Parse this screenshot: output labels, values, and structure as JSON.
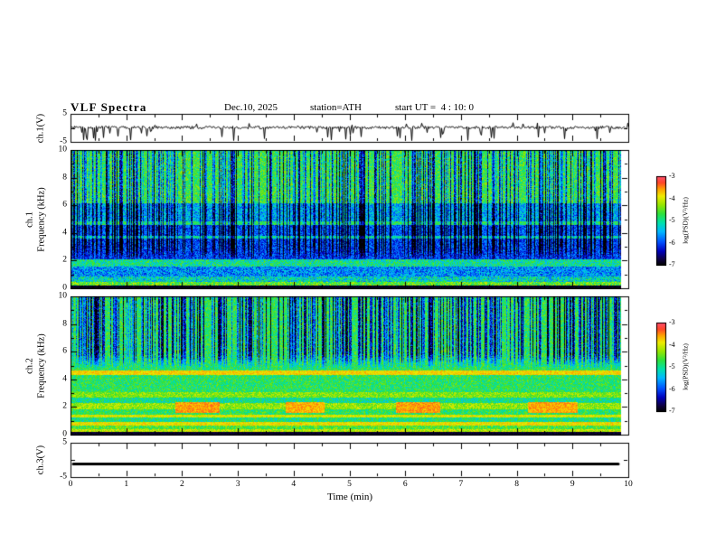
{
  "header": {
    "title": "VLF Spectra",
    "date": "Dec.10, 2025",
    "station": "station=ATH",
    "start_ut": "start UT =  4 : 10: 0"
  },
  "axes": {
    "x_label": "Time (min)",
    "x_ticks": [
      "0",
      "1",
      "2",
      "3",
      "4",
      "5",
      "6",
      "7",
      "8",
      "9",
      "10"
    ],
    "x_range": [
      0,
      10
    ]
  },
  "panels": {
    "ch1_wave": {
      "ylabel": "ch.1(V)",
      "yticks": [
        "5",
        "-5"
      ],
      "ylim": [
        -5,
        5
      ]
    },
    "spec1": {
      "ylabel_line1": "ch.1",
      "ylabel_line2": "Frequency (kHz)",
      "yticks": [
        "10",
        "8",
        "6",
        "4",
        "2",
        "0"
      ],
      "ylim": [
        0,
        10
      ]
    },
    "spec2": {
      "ylabel_line1": "ch.2",
      "ylabel_line2": "Frequency (kHz)",
      "yticks": [
        "10",
        "8",
        "6",
        "4",
        "2",
        "0"
      ],
      "ylim": [
        0,
        10
      ]
    },
    "ch3": {
      "ylabel": "ch.3(V)",
      "yticks": [
        "5",
        "-5"
      ],
      "ylim": [
        -5,
        5
      ]
    }
  },
  "colorbar": {
    "label": "log(PSD)(V²/Hz)",
    "ticks": [
      "-3",
      "-4",
      "-5",
      "-6",
      "-7"
    ],
    "range": [
      -7,
      -3
    ]
  },
  "chart_data": [
    {
      "type": "line",
      "name": "ch1-voltage-waveform",
      "ylabel": "ch.1(V)",
      "xlim": [
        0,
        10
      ],
      "ylim": [
        -5,
        5
      ],
      "description": "Noisy ch.1 voltage trace fluctuating near 0 V with dense impulsive spikes, mostly downward to about -5 V, some upward to about +3 V",
      "baseline": 0.3,
      "noise_amp": 0.5,
      "spike_rate": 0.09,
      "spike_down": 3.9,
      "spike_up": 2.0,
      "data_fraction": 1.0
    },
    {
      "type": "heatmap",
      "name": "ch1-spectrogram",
      "ylabel": "ch.1 Frequency (kHz)",
      "xlim": [
        0,
        10
      ],
      "ylim": [
        0,
        10
      ],
      "colormap_range_log_psd": [
        -7,
        -3
      ],
      "data_fraction": 0.985,
      "description": "VLF spectrogram: green/yellow background above ~6 kHz with dense dark-blue vertical sferic streaks, dark blue 2-6 kHz with cyan horizontal lines near 3.7 and 4.7 kHz, mixed cyan/green bands below 2 kHz, black band at 0 kHz",
      "bands": [
        {
          "f0": 0.0,
          "f1": 0.25,
          "v": 0.03,
          "noise": 0.03
        },
        {
          "f0": 0.25,
          "f1": 0.5,
          "v": 0.62,
          "noise": 0.15
        },
        {
          "f0": 0.5,
          "f1": 0.85,
          "v": 0.45,
          "noise": 0.18
        },
        {
          "f0": 0.85,
          "f1": 1.6,
          "v": 0.33,
          "noise": 0.15
        },
        {
          "f0": 1.6,
          "f1": 2.1,
          "v": 0.5,
          "noise": 0.15
        },
        {
          "f0": 2.1,
          "f1": 3.6,
          "v": 0.25,
          "noise": 0.12
        },
        {
          "f0": 3.6,
          "f1": 3.85,
          "v": 0.5,
          "noise": 0.1
        },
        {
          "f0": 3.85,
          "f1": 4.6,
          "v": 0.27,
          "noise": 0.12
        },
        {
          "f0": 4.6,
          "f1": 4.85,
          "v": 0.55,
          "noise": 0.1
        },
        {
          "f0": 4.85,
          "f1": 6.2,
          "v": 0.37,
          "noise": 0.15
        },
        {
          "f0": 6.2,
          "f1": 10.1,
          "v": 0.58,
          "noise": 0.13
        }
      ],
      "streaks": {
        "density": 0.45,
        "strength": 0.5,
        "f_min": 2.0
      },
      "patches": []
    },
    {
      "type": "heatmap",
      "name": "ch2-spectrogram",
      "ylabel": "ch.2 Frequency (kHz)",
      "xlim": [
        0,
        10
      ],
      "ylim": [
        0,
        10
      ],
      "colormap_range_log_psd": [
        -7,
        -3
      ],
      "data_fraction": 0.985,
      "description": "VLF spectrogram: green background above ~5 kHz with dense dark-blue vertical streaks, strong yellow/orange horizontal banding below 5 kHz, reddish-brown patches near 2 kHz around minutes 2, 4, 6 and 9, black band at 0 kHz",
      "bands": [
        {
          "f0": 0.0,
          "f1": 0.2,
          "v": 0.04,
          "noise": 0.03
        },
        {
          "f0": 0.2,
          "f1": 0.45,
          "v": 0.72,
          "noise": 0.1
        },
        {
          "f0": 0.45,
          "f1": 0.7,
          "v": 0.6,
          "noise": 0.12
        },
        {
          "f0": 0.7,
          "f1": 0.95,
          "v": 0.78,
          "noise": 0.08
        },
        {
          "f0": 0.95,
          "f1": 1.25,
          "v": 0.52,
          "noise": 0.12
        },
        {
          "f0": 1.25,
          "f1": 1.5,
          "v": 0.75,
          "noise": 0.08
        },
        {
          "f0": 1.5,
          "f1": 1.85,
          "v": 0.55,
          "noise": 0.12
        },
        {
          "f0": 1.85,
          "f1": 2.35,
          "v": 0.68,
          "noise": 0.1
        },
        {
          "f0": 2.35,
          "f1": 2.7,
          "v": 0.5,
          "noise": 0.12
        },
        {
          "f0": 2.7,
          "f1": 3.1,
          "v": 0.66,
          "noise": 0.1
        },
        {
          "f0": 3.1,
          "f1": 4.35,
          "v": 0.55,
          "noise": 0.12
        },
        {
          "f0": 4.35,
          "f1": 4.65,
          "v": 0.8,
          "noise": 0.07
        },
        {
          "f0": 4.65,
          "f1": 10.1,
          "v": 0.56,
          "noise": 0.12
        }
      ],
      "streaks": {
        "density": 0.5,
        "strength": 0.55,
        "f_min": 4.7
      },
      "patches": [
        {
          "t0": 1.9,
          "t1": 2.7,
          "f0": 1.6,
          "f1": 2.4,
          "v": 0.86
        },
        {
          "t0": 3.9,
          "t1": 4.6,
          "f0": 1.6,
          "f1": 2.4,
          "v": 0.84
        },
        {
          "t0": 5.9,
          "t1": 6.7,
          "f0": 1.6,
          "f1": 2.4,
          "v": 0.86
        },
        {
          "t0": 8.3,
          "t1": 9.2,
          "f0": 1.6,
          "f1": 2.4,
          "v": 0.85
        }
      ]
    },
    {
      "type": "line",
      "name": "ch3-voltage",
      "ylabel": "ch.3(V)",
      "xlim": [
        0,
        10
      ],
      "ylim": [
        -5,
        5
      ],
      "constant_value": -1,
      "linewidth": 3,
      "data_fraction": 0.985,
      "description": "Flat constant thick black line at about -1 V for the whole record (channel inactive)"
    }
  ]
}
